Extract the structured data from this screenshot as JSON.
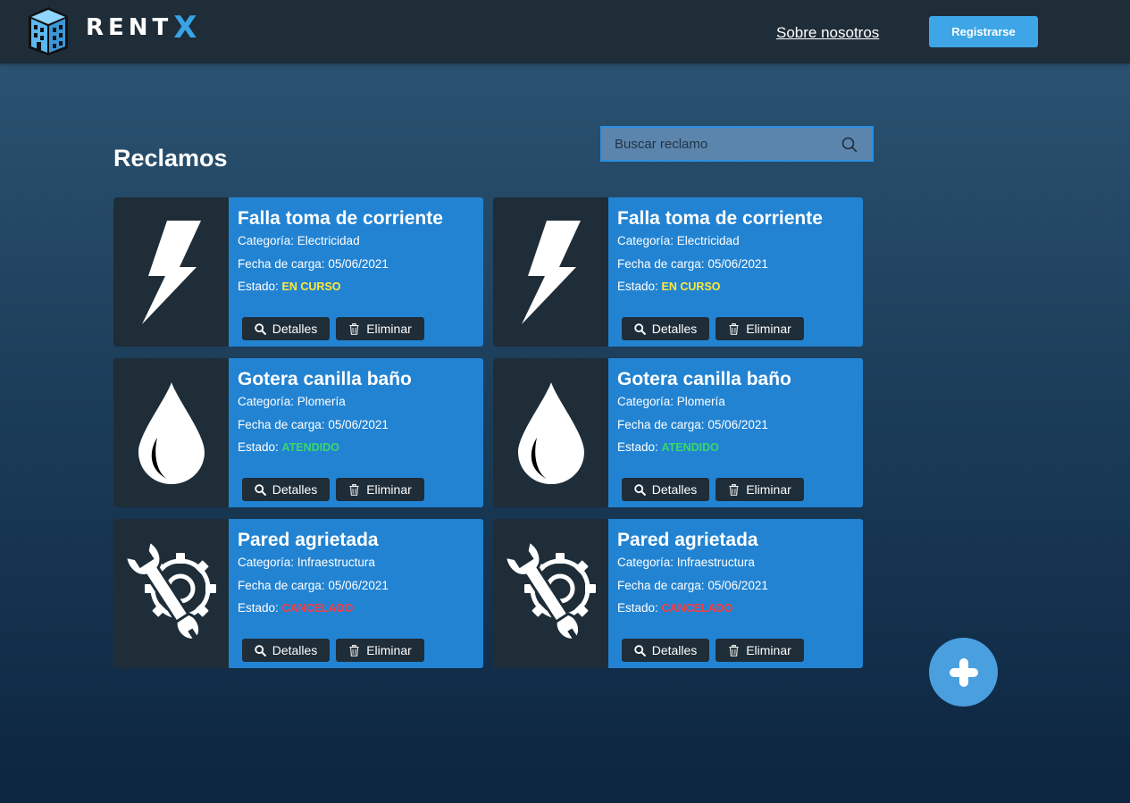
{
  "header": {
    "brand": "RENT",
    "brand_accent": "X",
    "nav_about": "Sobre nosotros",
    "register_label": "Registrarse"
  },
  "page": {
    "title": "Reclamos",
    "search_placeholder": "Buscar reclamo"
  },
  "labels": {
    "category_prefix": "Categoría: ",
    "date_prefix": "Fecha de carga: ",
    "status_prefix": "Estado: ",
    "details": "Detalles",
    "delete": "Eliminar"
  },
  "claims": [
    {
      "title": "Falla toma de corriente",
      "category": "Electricidad",
      "date": "05/06/2021",
      "status": "EN CURSO",
      "icon": "lightning-icon"
    },
    {
      "title": "Falla toma de corriente",
      "category": "Electricidad",
      "date": "05/06/2021",
      "status": "EN CURSO",
      "icon": "lightning-icon"
    },
    {
      "title": "Gotera canilla baño",
      "category": "Plomería",
      "date": "05/06/2021",
      "status": "ATENDIDO",
      "icon": "water-drop-icon"
    },
    {
      "title": "Gotera canilla baño",
      "category": "Plomería",
      "date": "05/06/2021",
      "status": "ATENDIDO",
      "icon": "water-drop-icon"
    },
    {
      "title": "Pared agrietada",
      "category": "Infraestructura",
      "date": "05/06/2021",
      "status": "CANCELADO",
      "icon": "wrench-gear-icon"
    },
    {
      "title": "Pared agrietada",
      "category": "Infraestructura",
      "date": "05/06/2021",
      "status": "CANCELADO",
      "icon": "wrench-gear-icon"
    }
  ],
  "colors": {
    "accent": "#3ea6e7",
    "card": "#2283d2",
    "dark": "#1e2d38",
    "status_en_curso": "#ffe93b",
    "status_atendido": "#3ad66b",
    "status_cancelado": "#ff3b3b"
  },
  "fab_icon": "plus-icon"
}
